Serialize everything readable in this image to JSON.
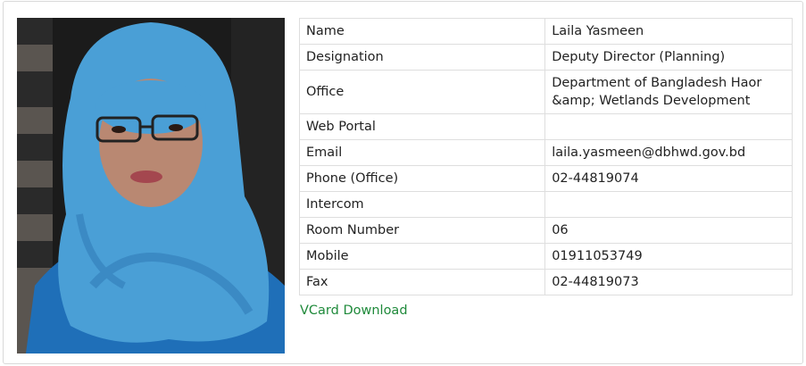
{
  "profile": {
    "photo_alt": "Laila Yasmeen",
    "rows": [
      {
        "label": "Name",
        "value": "Laila Yasmeen"
      },
      {
        "label": "Designation",
        "value": "Deputy Director (Planning)"
      },
      {
        "label": "Office",
        "value": "Department of Bangladesh Haor &amp; Wetlands Development"
      },
      {
        "label": "Web Portal",
        "value": ""
      },
      {
        "label": "Email",
        "value": "laila.yasmeen@dbhwd.gov.bd"
      },
      {
        "label": "Phone (Office)",
        "value": "02-44819074"
      },
      {
        "label": "Intercom",
        "value": ""
      },
      {
        "label": "Room Number",
        "value": "06"
      },
      {
        "label": "Mobile",
        "value": "01911053749"
      },
      {
        "label": "Fax",
        "value": "02-44819073"
      }
    ]
  },
  "actions": {
    "vcard_label": "VCard Download"
  },
  "colors": {
    "link": "#1f8a3b",
    "border": "#dedede",
    "hijab": "#4a9fd6",
    "dress": "#1f6fb8"
  }
}
